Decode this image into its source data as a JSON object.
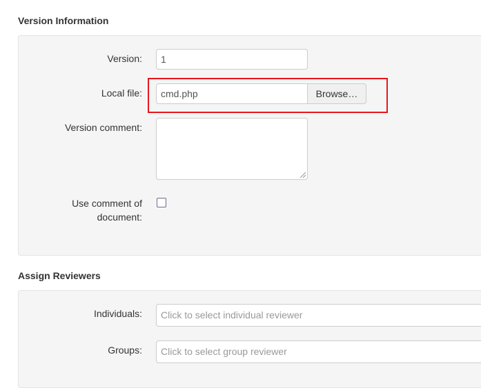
{
  "version_info": {
    "title": "Version Information",
    "version_label": "Version:",
    "version_value": "1",
    "local_file_label": "Local file:",
    "local_file_value": "cmd.php",
    "browse_label": "Browse…",
    "comment_label": "Version comment:",
    "comment_value": "",
    "use_comment_label_line1": "Use comment of",
    "use_comment_label_line2": "document:",
    "use_comment_checked": false
  },
  "reviewers": {
    "title": "Assign Reviewers",
    "individuals_label": "Individuals:",
    "individuals_placeholder": "Click to select individual reviewer",
    "groups_label": "Groups:",
    "groups_placeholder": "Click to select group reviewer"
  },
  "colors": {
    "highlight": "#e8141b",
    "panel_bg": "#f5f5f5"
  }
}
